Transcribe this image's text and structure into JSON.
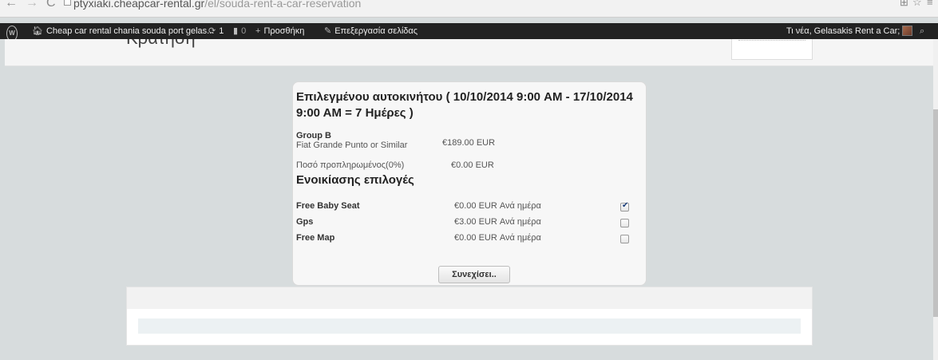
{
  "browser": {
    "url_host": "ptyxiaki.cheapcar-rental.gr",
    "url_path": "/el/souda-rent-a-car-reservation"
  },
  "adminbar": {
    "site_name": "Cheap car rental chania souda port gelas...",
    "updates_count": "1",
    "comments_count": "0",
    "new_label": "Προσθήκη",
    "edit_label": "Επεξεργασία σελίδας",
    "greeting": "Τι νέα, Gelasakis Rent a Car;"
  },
  "page": {
    "title": "Κράτηση"
  },
  "reservation": {
    "title": "Επιλεγμένου αυτοκινήτου ( 10/10/2014 9:00 AM - 17/10/2014 9:00 AM = 7 Ημέρες )",
    "group_name": "Group B",
    "car_model": "Fiat Grande Punto or Similar",
    "car_price": "€189.00 EUR",
    "prepaid_label": "Ποσό προπληρωμένος(0%)",
    "prepaid_amount": "€0.00 EUR",
    "options_title": "Ενοικίασης επιλογές",
    "options": [
      {
        "name": "Free Baby Seat",
        "price": "€0.00  EUR Ανά ημέρα",
        "checked": true
      },
      {
        "name": "Gps",
        "price": "€3.00  EUR Ανά ημέρα",
        "checked": false
      },
      {
        "name": "Free Map",
        "price": "€0.00  EUR Ανά ημέρα",
        "checked": false
      }
    ],
    "continue_label": "Συνεχίσει.."
  }
}
